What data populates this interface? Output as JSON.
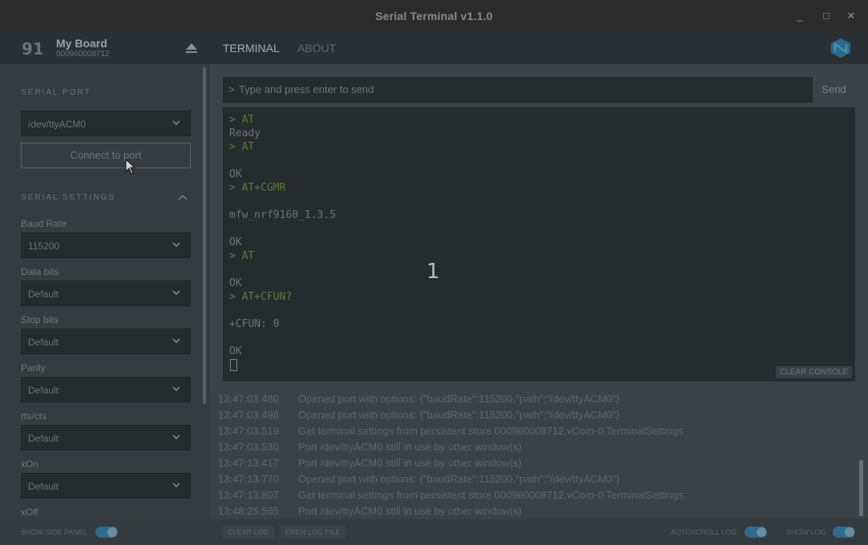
{
  "window": {
    "title": "Serial Terminal v1.1.0",
    "minimize": "_",
    "maximize": "□",
    "close": "✕"
  },
  "device": {
    "logo": "91",
    "name": "My Board",
    "serial": "000960008712"
  },
  "nav": {
    "tabs": [
      "TERMINAL",
      "ABOUT"
    ]
  },
  "sidebar": {
    "serial_port_title": "SERIAL PORT",
    "port_value": "/dev/ttyACM0",
    "connect_label": "Connect to port",
    "serial_settings_title": "SERIAL SETTINGS",
    "settings": [
      {
        "label": "Baud Rate",
        "value": "115200"
      },
      {
        "label": "Data bits",
        "value": "Default"
      },
      {
        "label": "Stop bits",
        "value": "Default"
      },
      {
        "label": "Parity",
        "value": "Default"
      },
      {
        "label": "rts/cts",
        "value": "Default"
      },
      {
        "label": "xOn",
        "value": "Default"
      },
      {
        "label": "xOff",
        "value": ""
      }
    ]
  },
  "send": {
    "prompt": ">",
    "placeholder": "Type and press enter to send",
    "button": "Send"
  },
  "console": {
    "lines": [
      "> AT",
      "Ready",
      "> AT",
      "",
      "OK",
      "> AT+CGMR",
      "",
      "mfw_nrf9160_1.3.5",
      "",
      "OK",
      "> AT",
      "",
      "OK",
      "> AT+CFUN?",
      "",
      "+CFUN: 0",
      "",
      "OK"
    ],
    "clear_label": "CLEAR CONSOLE"
  },
  "overlay_number": "1",
  "log": [
    {
      "time": "13:47:03.480",
      "message": "Opened port with options: {\"baudRate\":115200,\"path\":\"/dev/ttyACM0\"}"
    },
    {
      "time": "13:47:03.498",
      "message": "Opened port with options: {\"baudRate\":115200,\"path\":\"/dev/ttyACM0\"}"
    },
    {
      "time": "13:47:03.519",
      "message": "Get terminal settings from persistent store 000960008712.vCom-0.TerminalSettings"
    },
    {
      "time": "13:47:03.530",
      "message": "Port /dev/ttyACM0 still in use by other window(s)"
    },
    {
      "time": "13:47:13.417",
      "message": "Port /dev/ttyACM0 still in use by other window(s)"
    },
    {
      "time": "13:47:13.770",
      "message": "Opened port with options: {\"baudRate\":115200,\"path\":\"/dev/ttyACM0\"}"
    },
    {
      "time": "13:47:13.807",
      "message": "Get terminal settings from persistent store 000960008712.vCom-0.TerminalSettings"
    },
    {
      "time": "13:48:25.565",
      "message": "Port /dev/ttyACM0 still in use by other window(s)"
    }
  ],
  "footer": {
    "show_side_panel": "SHOW SIDE PANEL",
    "clear_log": "CLEAR LOG",
    "open_log_file": "OPEN LOG FILE",
    "autoscroll_log": "AUTOSCROLL LOG",
    "show_log": "SHOW LOG"
  }
}
